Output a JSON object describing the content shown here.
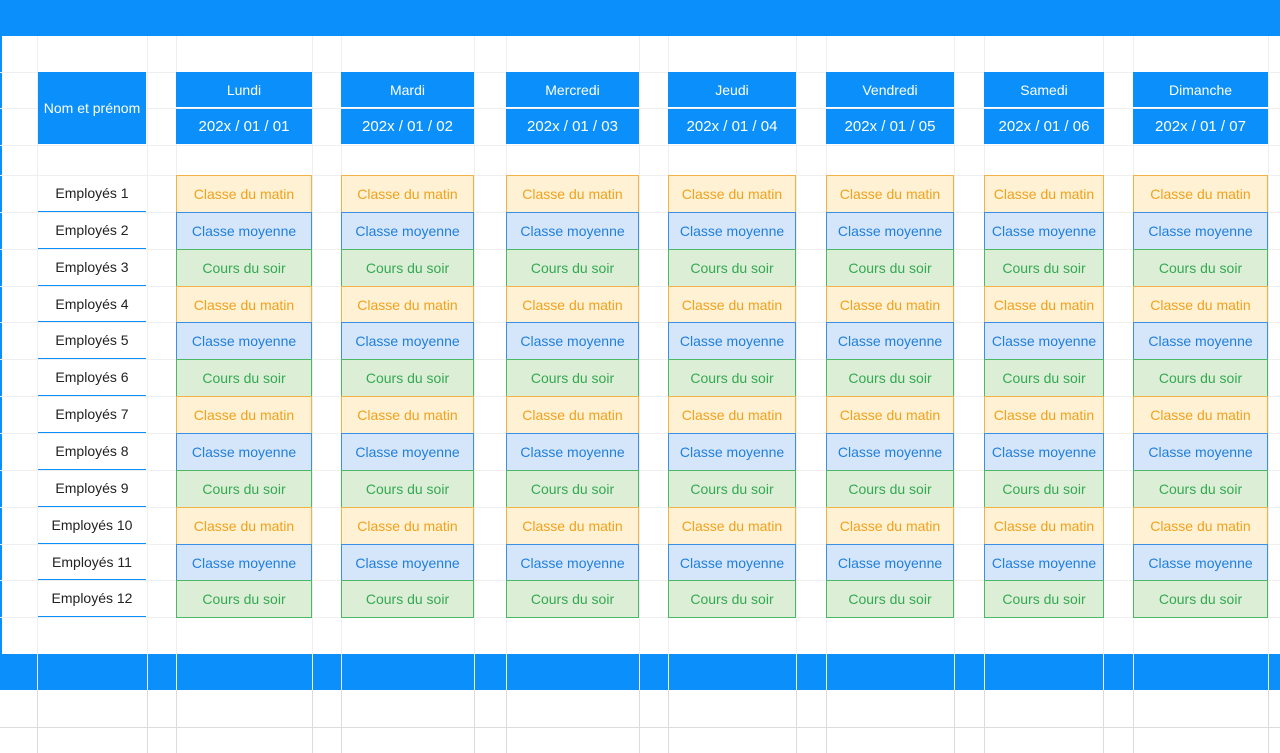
{
  "header_name": "Nom et prénom",
  "days": [
    {
      "name": "Lundi",
      "date": "202x / 01 / 01"
    },
    {
      "name": "Mardi",
      "date": "202x / 01 / 02"
    },
    {
      "name": "Mercredi",
      "date": "202x / 01 / 03"
    },
    {
      "name": "Jeudi",
      "date": "202x / 01 / 04"
    },
    {
      "name": "Vendredi",
      "date": "202x / 01 / 05"
    },
    {
      "name": "Samedi",
      "date": "202x / 01 / 06"
    },
    {
      "name": "Dimanche",
      "date": "202x / 01 / 07"
    }
  ],
  "employees": [
    "Employés 1",
    "Employés 2",
    "Employés 3",
    "Employés 4",
    "Employés 5",
    "Employés 6",
    "Employés 7",
    "Employés 8",
    "Employés 9",
    "Employés 10",
    "Employés 11",
    "Employés 12"
  ],
  "shift_types": {
    "matin": {
      "label": "Classe du matin",
      "bg": "#fff1d4",
      "border": "#f2b24a",
      "text": "#f0a21d"
    },
    "moyenne": {
      "label": "Classe moyenne",
      "bg": "#d5e6fb",
      "border": "#3b8fe6",
      "text": "#1f7fdb"
    },
    "soir": {
      "label": "Cours du soir",
      "bg": "#dcefd6",
      "border": "#4cb866",
      "text": "#35a853"
    }
  },
  "schedule_pattern": [
    "matin",
    "moyenne",
    "soir"
  ],
  "colors": {
    "accent": "#0a8ffb"
  }
}
